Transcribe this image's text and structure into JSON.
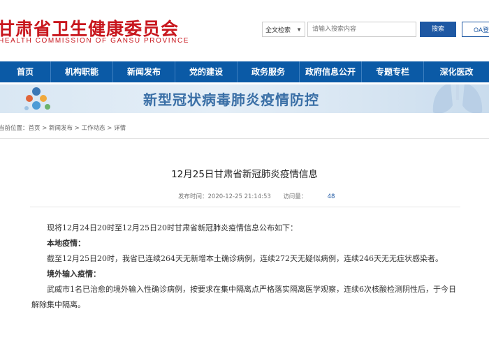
{
  "header": {
    "logo_cn": "甘肃省卫生健康委员会",
    "logo_en": "HEALTH COMMISSION OF GANSU PROVINCE",
    "search_scope": "全文检索",
    "search_placeholder": "请输入搜索内容",
    "search_button": "搜索",
    "oa_button": "OA登录"
  },
  "nav": [
    "首页",
    "机构职能",
    "新闻发布",
    "党的建设",
    "政务服务",
    "政府信息公开",
    "专题专栏",
    "深化医改"
  ],
  "banner": {
    "title": "新型冠状病毒肺炎疫情防控"
  },
  "breadcrumb": "当前位置：首页 > 新闻发布 > 工作动态 > 详情",
  "article": {
    "title": "12月25日甘肃省新冠肺炎疫情信息",
    "publish_label": "发布时间：",
    "publish_time": "2020-12-25 21:14:53",
    "views_label": "访问量：",
    "views": "48",
    "paragraphs": [
      {
        "text": "现将12月24日20时至12月25日20时甘肃省新冠肺炎疫情信息公布如下：",
        "bold": false
      },
      {
        "text": "本地疫情：",
        "bold": true
      },
      {
        "text": "截至12月25日20时，我省已连续264天无新增本土确诊病例，连续272天无疑似病例，连续246天无无症状感染者。",
        "bold": false
      },
      {
        "text": "境外输入疫情：",
        "bold": true
      },
      {
        "text": "武威市1名已治愈的境外输入性确诊病例，按要求在集中隔离点严格落实隔离医学观察，连续6次核酸检测阴性后，于今日解除集中隔离。",
        "bold": false
      }
    ]
  },
  "colors": {
    "brand_red": "#c8161d",
    "nav_blue": "#0b5aa6",
    "button_blue": "#1e58a3"
  }
}
